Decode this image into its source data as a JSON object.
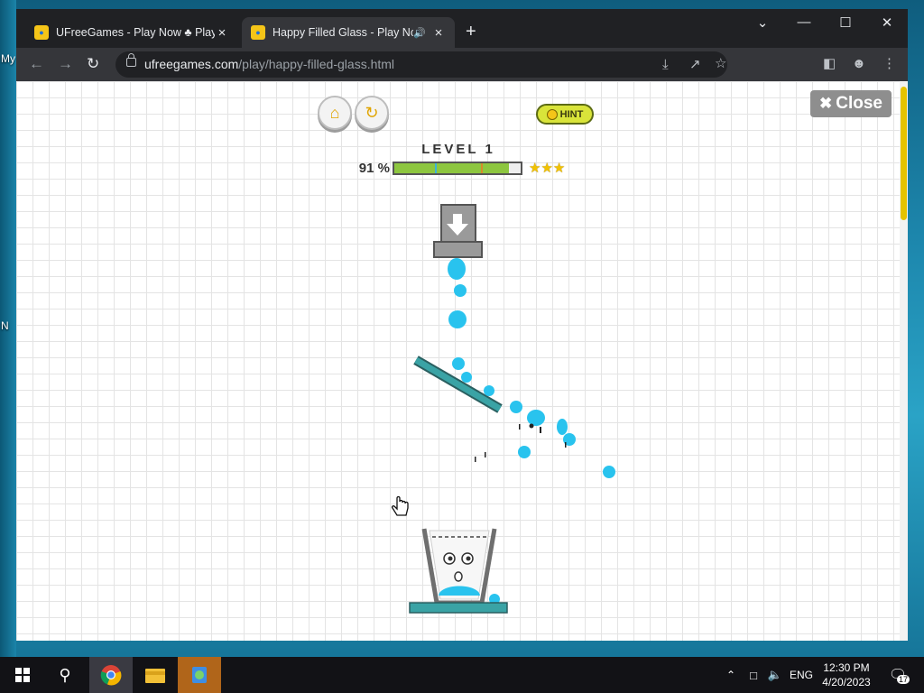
{
  "desktop": {
    "labels": [
      "My",
      "N"
    ]
  },
  "browser": {
    "tabs": [
      {
        "title": "UFreeGames - Play Now ♣ Play",
        "active": false
      },
      {
        "title": "Happy Filled Glass - Play Now",
        "active": true
      }
    ],
    "url_host": "ufreegames.com",
    "url_path": "/play/happy-filled-glass.html"
  },
  "game": {
    "close_label": "Close",
    "hint_label": "HINT",
    "level_label": "LEVEL 1",
    "progress_text": "91 %",
    "progress_value": 0.91,
    "stars": "★★★",
    "icons": [
      "home-icon",
      "restart-icon",
      "lightbulb-icon",
      "close-icon",
      "download-arrow-icon",
      "hand-cursor-icon"
    ]
  },
  "taskbar": {
    "language": "ENG",
    "time": "12:30 PM",
    "date": "4/20/2023",
    "notification_count": "17"
  },
  "colors": {
    "water": "#29c3ee",
    "platform": "#3aa3a5",
    "progress_fill": "#8dc63f",
    "scrollbar_thumb": "#e5c300",
    "close_button": "#8e8e8e"
  }
}
